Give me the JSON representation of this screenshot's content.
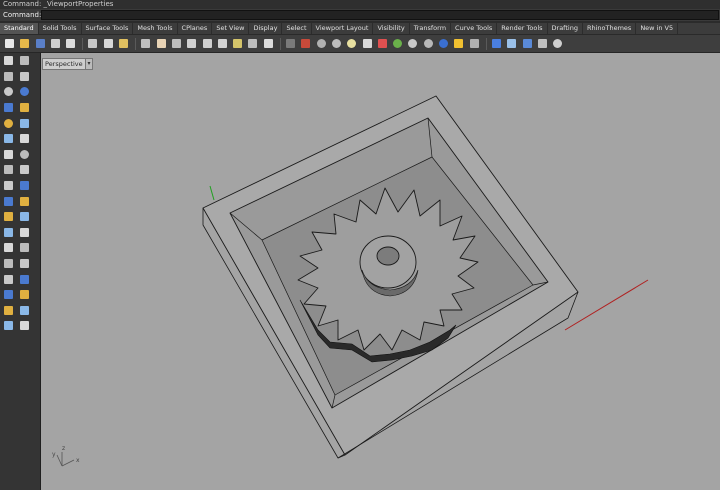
{
  "history_text": "Command: _ViewportProperties",
  "command": {
    "label": "Command:",
    "value": ""
  },
  "tabs": [
    "Standard",
    "Solid Tools",
    "Surface Tools",
    "Mesh Tools",
    "CPlanes",
    "Set View",
    "Display",
    "Select",
    "Viewport Layout",
    "Visibility",
    "Transform",
    "Curve Tools",
    "Render Tools",
    "Drafting",
    "RhinoThemes",
    "New in V5"
  ],
  "active_tab": "Standard",
  "toolbar_icons": [
    {
      "name": "new-file-icon",
      "color": "#e8e8e8"
    },
    {
      "name": "open-folder-icon",
      "color": "#e6b84a"
    },
    {
      "name": "save-icon",
      "color": "#5a7fc8"
    },
    {
      "name": "print-icon",
      "color": "#cfcfcf"
    },
    {
      "name": "import-icon",
      "color": "#dcdcdc"
    },
    {
      "name": "cut-icon",
      "color": "#c8c8c8"
    },
    {
      "name": "copy-icon",
      "color": "#d8d8d8"
    },
    {
      "name": "paste-icon",
      "color": "#e0c060"
    },
    {
      "name": "undo-icon",
      "color": "#bfbfbf"
    },
    {
      "name": "pan-hand-icon",
      "color": "#e8d3b5"
    },
    {
      "name": "rotate-view-icon",
      "color": "#bdbdbd"
    },
    {
      "name": "zoom-icon",
      "color": "#d0d0d0"
    },
    {
      "name": "zoom-window-icon",
      "color": "#cfcfcf"
    },
    {
      "name": "zoom-extents-icon",
      "color": "#d2d2d2"
    },
    {
      "name": "zoom-selected-icon",
      "color": "#d4c46a"
    },
    {
      "name": "undo-view-icon",
      "color": "#bdbdbd"
    },
    {
      "name": "four-viewports-icon",
      "color": "#dcdcdc"
    },
    {
      "name": "cplane-icon",
      "color": "#7a7a7a"
    },
    {
      "name": "car-shade-icon",
      "color": "#c84a3a"
    },
    {
      "name": "point-icon",
      "color": "#b0b0b0"
    },
    {
      "name": "select-points-icon",
      "color": "#bcbcbc"
    },
    {
      "name": "lightbulb-icon",
      "color": "#e8e0a0"
    },
    {
      "name": "lock-icon",
      "color": "#d8d8d8"
    },
    {
      "name": "layer-icon",
      "color": "#e05050"
    },
    {
      "name": "color-wheel-icon",
      "color": "#6ab04a"
    },
    {
      "name": "sphere-render-icon",
      "color": "#c8c8c8"
    },
    {
      "name": "sphere-material-icon",
      "color": "#b8b8b8"
    },
    {
      "name": "globe-icon",
      "color": "#3a6fd0"
    },
    {
      "name": "sun-icon",
      "color": "#f0c030"
    },
    {
      "name": "properties-icon",
      "color": "#b0b0b0"
    },
    {
      "name": "help-icon",
      "color": "#4a7fe0"
    },
    {
      "name": "grid-icon",
      "color": "#9ac0e8"
    },
    {
      "name": "snap-grid-icon",
      "color": "#5a8ad8"
    },
    {
      "name": "dimension-icon",
      "color": "#c0c0c0"
    },
    {
      "name": "target-icon",
      "color": "#cfcfcf"
    }
  ],
  "left_tools": [
    [
      "select-arrow-icon",
      "point-icon"
    ],
    [
      "polyline-icon",
      "curve-icon"
    ],
    [
      "circle-icon",
      "arc-icon"
    ],
    [
      "polygon-icon",
      "rectangle-icon"
    ],
    [
      "ellipse-icon",
      "freeform-curve-icon"
    ],
    [
      "surface-icon",
      "loft-icon"
    ],
    [
      "box-icon",
      "sphere-icon"
    ],
    [
      "cylinder-icon",
      "extrude-icon"
    ],
    [
      "boolean-union-icon",
      "fillet-icon"
    ],
    [
      "split-icon",
      "trim-icon"
    ],
    [
      "explode-icon",
      "join-icon"
    ],
    [
      "offset-icon",
      "move-icon"
    ],
    [
      "text-icon",
      "dimension-icon"
    ],
    [
      "scale-icon",
      "mirror-icon"
    ],
    [
      "mesh-icon",
      "cage-icon"
    ],
    [
      "array-icon",
      "align-icon"
    ],
    [
      "analyze-icon",
      "check-icon"
    ],
    [
      "render-icon",
      "light-icon"
    ]
  ],
  "viewport": {
    "title": "Perspective",
    "dropdown": "▾",
    "axis_labels": {
      "x": "x",
      "y": "y",
      "z": "z"
    }
  },
  "colors": {
    "viewport_bg": "#a4a4a4",
    "x_axis": "#b02020",
    "y_axis": "#20a020",
    "model_line": "#1a1a1a"
  }
}
